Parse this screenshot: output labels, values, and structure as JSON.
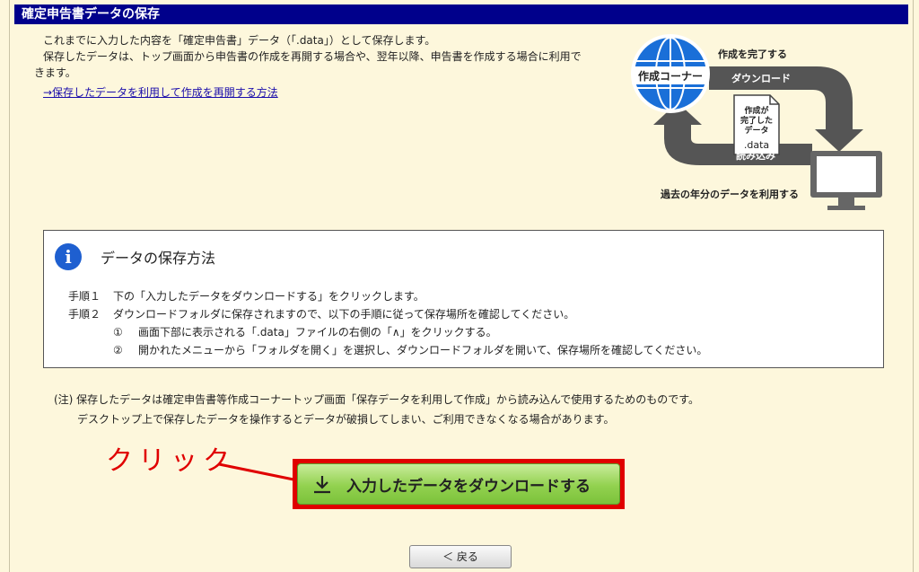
{
  "header": {
    "title": "確定申告書データの保存"
  },
  "intro": {
    "line1": "これまでに入力した内容を「確定申告書」データ（「.data」）として保存します。",
    "line2": "保存したデータは、トップ画面から申告書の作成を再開する場合や、翌年以降、申告書を作成する場合に利用で",
    "line3": "きます。",
    "link": "→保存したデータを利用して作成を再開する方法"
  },
  "diagram": {
    "globe_label": "作成コーナー",
    "complete_label": "作成を完了する",
    "download_label": "ダウンロード",
    "doc_lines": [
      "作成が",
      "完了した",
      "データ"
    ],
    "doc_ext": ".data",
    "read_label": "読み込み",
    "past_label": "過去の年分のデータを利用する",
    "colors": {
      "globe": "#1a6fd8",
      "arrow": "#555555",
      "monitor": "#666666"
    }
  },
  "info": {
    "title": "データの保存方法",
    "steps": [
      {
        "no": "手順１",
        "text": "下の「入力したデータをダウンロードする」をクリックします。"
      },
      {
        "no": "手順２",
        "text": "ダウンロードフォルダに保存されますので、以下の手順に従って保存場所を確認してください。"
      }
    ],
    "substeps": [
      {
        "no": "①",
        "text": "画面下部に表示される「.data」ファイルの右側の「∧」をクリックする。"
      },
      {
        "no": "②",
        "text": "開かれたメニューから「フォルダを開く」を選択し、ダウンロードフォルダを開いて、保存場所を確認してください。"
      }
    ]
  },
  "note": {
    "line1": "(注) 保存したデータは確定申告書等作成コーナートップ画面「保存データを利用して作成」から読み込んで使用するためのものです。",
    "line2": "デスクトップ上で保存したデータを操作するとデータが破損してしまい、ご利用できなくなる場合があります。"
  },
  "annotation": {
    "click_label": "クリック",
    "color": "#e00000"
  },
  "buttons": {
    "download": "入力したデータをダウンロードする",
    "back": "＜ 戻る"
  }
}
